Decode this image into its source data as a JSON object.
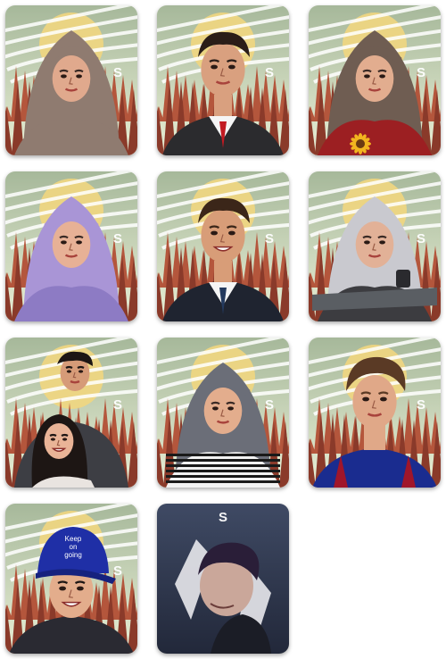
{
  "gallery": {
    "cards": [
      {
        "id": "portrait-1",
        "variant": "forest",
        "subject": "woman-hijab",
        "hijab": "#8f7b70",
        "clothes": "#8f7b70",
        "skin": "#e0a98d",
        "hair": "#3a2a25"
      },
      {
        "id": "portrait-2",
        "variant": "forest",
        "subject": "man-suit",
        "skin": "#d9a07f",
        "hair": "#2a1d18",
        "suit": "#2b2b2e",
        "tie": "#c21a22"
      },
      {
        "id": "portrait-3",
        "variant": "forest",
        "subject": "woman-hijab-flower",
        "hijab": "#6f5d52",
        "clothes": "#9c1f22",
        "skin": "#e2ad8f",
        "hair": "#3a2a25"
      },
      {
        "id": "portrait-4",
        "variant": "forest",
        "subject": "woman-hijab",
        "hijab": "#a995d6",
        "clothes": "#8d7bc4",
        "skin": "#e7b196",
        "hair": "#3a2a25"
      },
      {
        "id": "portrait-5",
        "variant": "forest",
        "subject": "man-suit-smile",
        "skin": "#d89d78",
        "hair": "#3b2619",
        "suit": "#1f2430",
        "tie": "#243a5e"
      },
      {
        "id": "portrait-6",
        "variant": "forest",
        "subject": "woman-hijab-watch",
        "hijab": "#c9c9cf",
        "clothes": "#3c3c40",
        "skin": "#e2b197",
        "hair": "#3a2a25"
      },
      {
        "id": "portrait-7",
        "variant": "forest",
        "subject": "couple",
        "skin": "#d69b78",
        "hair": "#1d1614",
        "shirt": "#3d3e44"
      },
      {
        "id": "portrait-8",
        "variant": "forest",
        "subject": "woman-hijab-stripes",
        "hijab": "#6b6e78",
        "clothes": "#f2f2f2",
        "skin": "#e3ad8d",
        "hair": "#3a2a25"
      },
      {
        "id": "portrait-9",
        "variant": "forest",
        "subject": "man-jersey",
        "skin": "#e0a888",
        "hair": "#5a3a25",
        "jersey": "#1a2c8f"
      },
      {
        "id": "portrait-10",
        "variant": "forest",
        "subject": "man-cap",
        "skin": "#e3ad8c",
        "hair": "#1d1614",
        "cap": "#1f2fa6",
        "cap_text": "Keep\non\ngoing"
      },
      {
        "id": "portrait-11",
        "variant": "dark",
        "subject": "man-profile",
        "skin": "#caa79a",
        "hair": "#2a1e38"
      }
    ],
    "watermark": "S",
    "colors": {
      "sky_top": "#a6b89a",
      "sky_bottom": "#e9efd6",
      "sun": "#f1d67f",
      "tree_dark": "#8a3a2a",
      "tree_light": "#b4563c",
      "cloud": "#ffffff",
      "dark_bg_top": "#3f4a64",
      "dark_bg_bottom": "#22283a"
    }
  }
}
